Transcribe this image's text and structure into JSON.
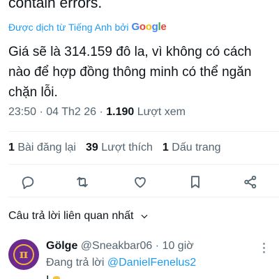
{
  "tweet": {
    "original_tail": "contain errors.",
    "translated_label": "Được dịch từ Tiếng Anh bởi",
    "translator_brand": [
      "G",
      "o",
      "o",
      "g",
      "l",
      "e"
    ],
    "text": "Giá sẽ là 314.159 đô la, vì không có cách nào để hợp đồng thông minh có thể ngăn chặn lỗi.",
    "time": "23:50",
    "date": "04 Th2 26",
    "views_count": "1.190",
    "views_label": "Lượt xem"
  },
  "stats": {
    "reposts_count": "1",
    "reposts_label": "Bài đăng lại",
    "likes_count": "39",
    "likes_label": "Lượt thích",
    "bookmarks_count": "1",
    "bookmarks_label": "Dấu trang"
  },
  "actions": [
    "reply-icon",
    "repost-icon",
    "like-icon",
    "bookmark-icon",
    "share-icon"
  ],
  "replies_sort": {
    "label": "Câu trả lời liên quan nhất"
  },
  "reply": {
    "avatar_symbol": "π",
    "name": "Gölge",
    "handle": "@Sneakbar06",
    "separator": "·",
    "time": "10 giờ",
    "replying_prefix": "Đang trả lời",
    "replying_to": "@DanielFenelus2",
    "peek_text": "I"
  },
  "colors": {
    "accent": "#1d9bf0",
    "text": "#0f1419",
    "secondary": "#536471",
    "avatar_bg": "#6b2a8e",
    "avatar_ring": "#f2b33d"
  }
}
